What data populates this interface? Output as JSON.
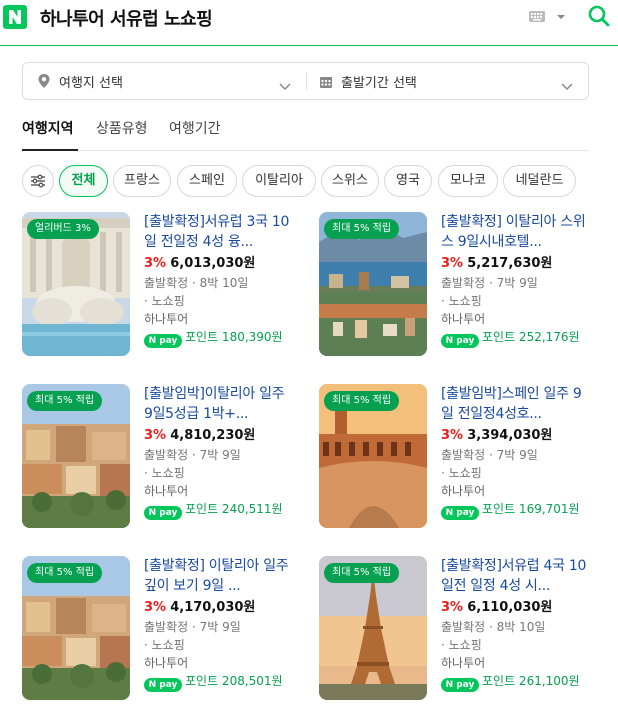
{
  "header": {
    "logo_icon": "naver-n-logo-icon",
    "title": "하나투어 서유럽 노쇼핑",
    "keyboard_icon": "keyboard-icon",
    "search_icon": "search-icon",
    "accent": "#03c75a"
  },
  "selector": {
    "destination": {
      "icon": "location-pin-icon",
      "label": "여행지 선택"
    },
    "departure": {
      "icon": "calendar-icon",
      "label": "출발기간 선택"
    }
  },
  "tabs": [
    {
      "label": "여행지역",
      "active": true
    },
    {
      "label": "상품유형",
      "active": false
    },
    {
      "label": "여행기간",
      "active": false
    }
  ],
  "filter_icon": "filter-sliders-icon",
  "chips": [
    {
      "label": "전체",
      "active": true
    },
    {
      "label": "프랑스",
      "active": false
    },
    {
      "label": "스페인",
      "active": false
    },
    {
      "label": "이탈리아",
      "active": false
    },
    {
      "label": "스위스",
      "active": false
    },
    {
      "label": "영국",
      "active": false
    },
    {
      "label": "모나코",
      "active": false
    },
    {
      "label": "네덜란드",
      "active": false
    }
  ],
  "products": [
    {
      "badge": "얼리버드 3%",
      "title": "[출발확정]서유럽 3국 10일 전일정 4성 융...",
      "discount": "3%",
      "price": "6,013,030원",
      "meta1": "출발확정 · 8박 10일",
      "meta2": "· 노쇼핑",
      "seller": "하나투어",
      "pay_badge": "N pay",
      "points": "포인트 180,390원",
      "image": "trevi-fountain"
    },
    {
      "badge": "최대 5% 적립",
      "title": "[출발확정] 이탈리아 스위스 9일시내호텔...",
      "discount": "3%",
      "price": "5,217,630원",
      "meta1": "출발확정 · 7박 9일",
      "meta2": "· 노쇼핑",
      "seller": "하나투어",
      "pay_badge": "N pay",
      "points": "포인트 252,176원",
      "image": "lucerne-lake"
    },
    {
      "badge": "최대 5% 적립",
      "title": "[출발임박]이탈리아 일주 9일5성급 1박+...",
      "discount": "3%",
      "price": "4,810,230원",
      "meta1": "출발확정 · 7박 9일",
      "meta2": "· 노쇼핑",
      "seller": "하나투어",
      "pay_badge": "N pay",
      "points": "포인트 240,511원",
      "image": "rome-city"
    },
    {
      "badge": "최대 5% 적립",
      "title": "[출발임박]스페인 일주 9일 전일정4성호...",
      "discount": "3%",
      "price": "3,394,030원",
      "meta1": "출발확정 · 7박 9일",
      "meta2": "· 노쇼핑",
      "seller": "하나투어",
      "pay_badge": "N pay",
      "points": "포인트 169,701원",
      "image": "plaza-de-espana"
    },
    {
      "badge": "최대 5% 적립",
      "title": "[출발확정] 이탈리아 일주 깊이 보기 9일 ...",
      "discount": "3%",
      "price": "4,170,030원",
      "meta1": "출발확정 · 7박 9일",
      "meta2": "· 노쇼핑",
      "seller": "하나투어",
      "pay_badge": "N pay",
      "points": "포인트 208,501원",
      "image": "rome-city"
    },
    {
      "badge": "최대 5% 적립",
      "title": "[출발확정]서유럽 4국 10일전 일정 4성 시...",
      "discount": "3%",
      "price": "6,110,030원",
      "meta1": "출발확정 · 8박 10일",
      "meta2": "· 노쇼핑",
      "seller": "하나투어",
      "pay_badge": "N pay",
      "points": "포인트 261,100원",
      "image": "eiffel-tower"
    }
  ]
}
